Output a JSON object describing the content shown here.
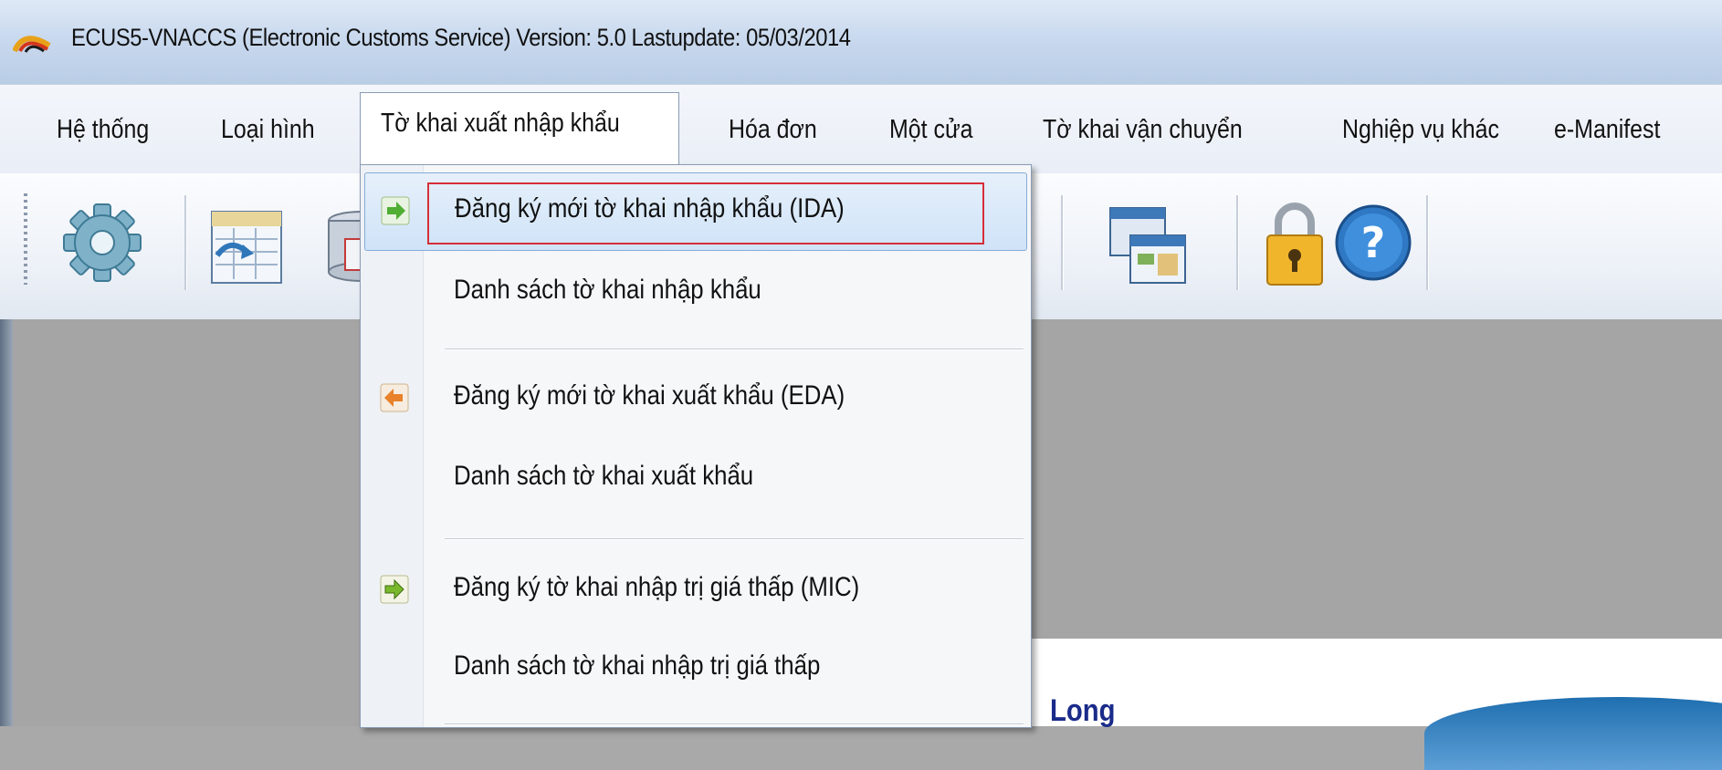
{
  "window": {
    "title": "ECUS5-VNACCS (Electronic Customs Service) Version: 5.0 Lastupdate: 05/03/2014"
  },
  "menubar": {
    "items": [
      {
        "label": "Hệ thống"
      },
      {
        "label": "Loại hình"
      },
      {
        "label": "Tờ khai xuất nhập khẩu",
        "active": true
      },
      {
        "label": "Hóa đơn"
      },
      {
        "label": "Một cửa"
      },
      {
        "label": "Tờ khai vận chuyển"
      },
      {
        "label": "Nghiệp vụ khác"
      },
      {
        "label": "e-Manifest"
      }
    ]
  },
  "toolbar": {
    "buttons": [
      {
        "icon": "gear-icon"
      },
      {
        "icon": "calendar-form-icon"
      },
      {
        "icon": "database-icon"
      },
      {
        "icon": "windows-icon"
      },
      {
        "icon": "lock-icon"
      },
      {
        "icon": "help-icon"
      }
    ]
  },
  "dropdown": {
    "items": [
      {
        "label": "Đăng ký mới tờ khai nhập khẩu (IDA)",
        "icon": "import-arrow-icon",
        "highlighted": true
      },
      {
        "label": "Danh sách tờ khai nhập khẩu"
      },
      {
        "label": "Đăng ký mới tờ khai xuất khẩu (EDA)",
        "icon": "export-arrow-icon"
      },
      {
        "label": "Danh sách tờ khai xuất khẩu"
      },
      {
        "label": "Đăng ký tờ khai nhập trị giá thấp (MIC)",
        "icon": "low-value-import-icon"
      },
      {
        "label": "Danh sách tờ khai nhập trị giá thấp"
      }
    ]
  },
  "background_doc": {
    "partial_text": "Long"
  },
  "colors": {
    "highlight_border": "#d62f3a",
    "hover_fill": "#cfe3f8",
    "workspace": "#a5a5a5"
  }
}
